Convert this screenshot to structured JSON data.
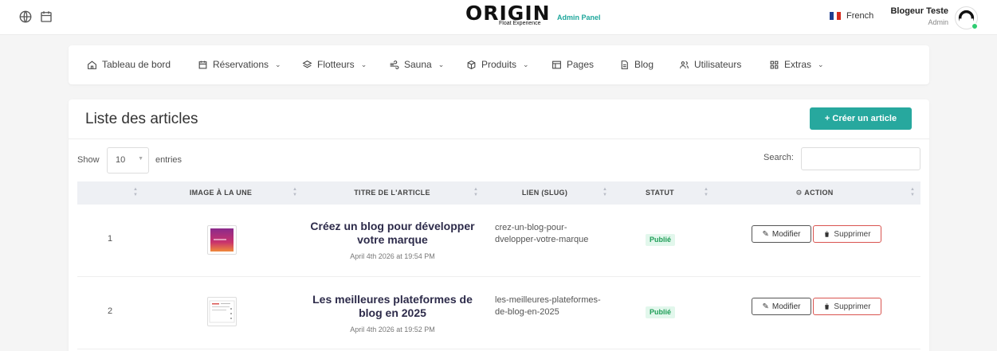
{
  "header": {
    "logo_text": "ORIGIN",
    "logo_tagline": "Float Experience",
    "panel_label": "Admin Panel",
    "language": "French",
    "user_name": "Blogeur Teste",
    "user_role": "Admin"
  },
  "nav": {
    "items": [
      {
        "label": "Tableau de bord",
        "icon": "home-icon",
        "dropdown": false
      },
      {
        "label": "Réservations",
        "icon": "calendar-icon",
        "dropdown": true
      },
      {
        "label": "Flotteurs",
        "icon": "layers-icon",
        "dropdown": true
      },
      {
        "label": "Sauna",
        "icon": "wind-icon",
        "dropdown": true
      },
      {
        "label": "Produits",
        "icon": "box-icon",
        "dropdown": true
      },
      {
        "label": "Pages",
        "icon": "layout-icon",
        "dropdown": false
      },
      {
        "label": "Blog",
        "icon": "file-icon",
        "dropdown": false
      },
      {
        "label": "Utilisateurs",
        "icon": "users-icon",
        "dropdown": false
      },
      {
        "label": "Extras",
        "icon": "grid-icon",
        "dropdown": true
      }
    ]
  },
  "main": {
    "title": "Liste des articles",
    "create_button": "+ Créer un article",
    "show_label": "Show",
    "entries_value": "10",
    "entries_label": "entries",
    "search_label": "Search:",
    "search_value": "",
    "columns": [
      "IMAGE À LA UNE",
      "TITRE DE L'ARTICLE",
      "LIEN (SLUG)",
      "STATUT",
      "ACTION"
    ],
    "rows": [
      {
        "num": "1",
        "title": "Créez un blog pour développer votre marque",
        "date": "April 4th 2026 at 19:54 PM",
        "slug": "crez-un-blog-pour-dvelopper-votre-marque",
        "status": "Publié",
        "edit": "Modifier",
        "delete": "Supprimer"
      },
      {
        "num": "2",
        "title": "Les meilleures plateformes de blog en 2025",
        "date": "April 4th 2026 at 19:52 PM",
        "slug": "les-meilleures-plateformes-de-blog-en-2025",
        "status": "Publié",
        "edit": "Modifier",
        "delete": "Supprimer"
      }
    ]
  },
  "colors": {
    "accent": "#27a89e",
    "status_green": "#1f9e57",
    "danger": "#d9534f"
  }
}
